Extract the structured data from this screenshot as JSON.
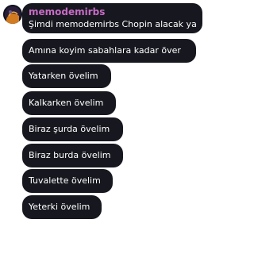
{
  "chat": {
    "username": "memodemirbs",
    "username_color": "#c86bc6",
    "bubble_color": "#17181f",
    "messages": [
      "Şimdi memodemirbs Chopin alacak ya",
      "Amına koyim sabahlara kadar över",
      "Yatarken övelim",
      "Kalkarken övelim",
      "Biraz şurda övelim",
      "Biraz burda övelim",
      "Tuvalette övelim",
      "Yeterki övelim"
    ]
  }
}
